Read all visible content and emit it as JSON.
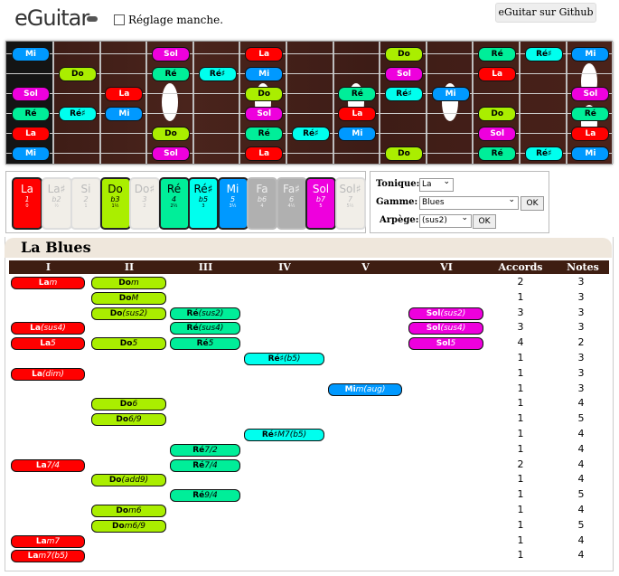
{
  "app": {
    "logo_text": "eGuitar",
    "checkbox_label": "Réglage manche.",
    "github_button": "eGuitar sur Github"
  },
  "colors": {
    "Do": "#aaee00",
    "Ré": "#00ee99",
    "Ré♯": "#00ffee",
    "Mi": "#0099ff",
    "Sol": "#ee00dd",
    "La": "#ff0000"
  },
  "fretboard": {
    "strings": [
      "Mi",
      "Si",
      "Sol",
      "Ré",
      "La",
      "Mi"
    ],
    "notes": [
      {
        "s": 0,
        "f": 0,
        "n": "Mi"
      },
      {
        "s": 0,
        "f": 3,
        "n": "Sol"
      },
      {
        "s": 0,
        "f": 5,
        "n": "La"
      },
      {
        "s": 0,
        "f": 8,
        "n": "Do"
      },
      {
        "s": 0,
        "f": 10,
        "n": "Ré"
      },
      {
        "s": 0,
        "f": 11,
        "n": "Ré♯"
      },
      {
        "s": 0,
        "f": 12,
        "n": "Mi"
      },
      {
        "s": 1,
        "f": 1,
        "n": "Do"
      },
      {
        "s": 1,
        "f": 3,
        "n": "Ré"
      },
      {
        "s": 1,
        "f": 4,
        "n": "Ré♯"
      },
      {
        "s": 1,
        "f": 5,
        "n": "Mi"
      },
      {
        "s": 1,
        "f": 8,
        "n": "Sol"
      },
      {
        "s": 1,
        "f": 10,
        "n": "La"
      },
      {
        "s": 2,
        "f": 0,
        "n": "Sol"
      },
      {
        "s": 2,
        "f": 2,
        "n": "La"
      },
      {
        "s": 2,
        "f": 5,
        "n": "Do"
      },
      {
        "s": 2,
        "f": 7,
        "n": "Ré"
      },
      {
        "s": 2,
        "f": 8,
        "n": "Ré♯"
      },
      {
        "s": 2,
        "f": 9,
        "n": "Mi"
      },
      {
        "s": 2,
        "f": 12,
        "n": "Sol"
      },
      {
        "s": 3,
        "f": 0,
        "n": "Ré"
      },
      {
        "s": 3,
        "f": 1,
        "n": "Ré♯"
      },
      {
        "s": 3,
        "f": 2,
        "n": "Mi"
      },
      {
        "s": 3,
        "f": 5,
        "n": "Sol"
      },
      {
        "s": 3,
        "f": 7,
        "n": "La"
      },
      {
        "s": 3,
        "f": 10,
        "n": "Do"
      },
      {
        "s": 3,
        "f": 12,
        "n": "Ré"
      },
      {
        "s": 4,
        "f": 0,
        "n": "La"
      },
      {
        "s": 4,
        "f": 3,
        "n": "Do"
      },
      {
        "s": 4,
        "f": 5,
        "n": "Ré"
      },
      {
        "s": 4,
        "f": 6,
        "n": "Ré♯"
      },
      {
        "s": 4,
        "f": 7,
        "n": "Mi"
      },
      {
        "s": 4,
        "f": 10,
        "n": "Sol"
      },
      {
        "s": 4,
        "f": 12,
        "n": "La"
      },
      {
        "s": 5,
        "f": 0,
        "n": "Mi"
      },
      {
        "s": 5,
        "f": 3,
        "n": "Sol"
      },
      {
        "s": 5,
        "f": 5,
        "n": "La"
      },
      {
        "s": 5,
        "f": 8,
        "n": "Do"
      },
      {
        "s": 5,
        "f": 10,
        "n": "Ré"
      },
      {
        "s": 5,
        "f": 11,
        "n": "Ré♯"
      },
      {
        "s": 5,
        "f": 12,
        "n": "Mi"
      }
    ]
  },
  "degrees": [
    {
      "name": "La",
      "interval": "1",
      "ratio": "0",
      "active": true,
      "color": "#ff0000",
      "text": "#ffffff"
    },
    {
      "name": "La♯",
      "interval": "b2",
      "ratio": "½",
      "active": false
    },
    {
      "name": "Si",
      "interval": "2",
      "ratio": "1",
      "active": false
    },
    {
      "name": "Do",
      "interval": "b3",
      "ratio": "1½",
      "active": true,
      "color": "#aaee00",
      "text": "#000000"
    },
    {
      "name": "Do♯",
      "interval": "3",
      "ratio": "2",
      "active": false
    },
    {
      "name": "Ré",
      "interval": "4",
      "ratio": "2½",
      "active": true,
      "color": "#00ee99",
      "text": "#000000"
    },
    {
      "name": "Ré♯",
      "interval": "b5",
      "ratio": "3",
      "active": true,
      "color": "#00ffee",
      "text": "#000000"
    },
    {
      "name": "Mi",
      "interval": "5",
      "ratio": "3½",
      "active": true,
      "color": "#0099ff",
      "text": "#ffffff"
    },
    {
      "name": "Fa",
      "interval": "b6",
      "ratio": "4",
      "active": false,
      "dark": true
    },
    {
      "name": "Fa♯",
      "interval": "6",
      "ratio": "4½",
      "active": false,
      "dark": true
    },
    {
      "name": "Sol",
      "interval": "b7",
      "ratio": "5",
      "active": true,
      "color": "#ee00dd",
      "text": "#ffffff"
    },
    {
      "name": "Sol♯",
      "interval": "7",
      "ratio": "5½",
      "active": false
    }
  ],
  "controls": {
    "tonique_label": "Tonique:",
    "tonique_value": "La",
    "gamme_label": "Gamme:",
    "gamme_value": "Blues",
    "ok1": "OK",
    "arpege_label": "Arpège:",
    "arpege_value": "(sus2)",
    "ok2": "OK"
  },
  "table": {
    "title": "La Blues",
    "headers": [
      "I",
      "II",
      "III",
      "IV",
      "V",
      "VI",
      "Accords",
      "Notes"
    ],
    "rows": [
      {
        "chords": [
          {
            "col": 0,
            "root": "La",
            "q": "m"
          },
          {
            "col": 1,
            "root": "Do",
            "q": "m"
          }
        ],
        "accords": "2",
        "notes": "3"
      },
      {
        "chords": [
          {
            "col": 1,
            "root": "Do",
            "q": "M"
          }
        ],
        "accords": "1",
        "notes": "3"
      },
      {
        "chords": [
          {
            "col": 1,
            "root": "Do",
            "q": "(sus2)"
          },
          {
            "col": 2,
            "root": "Ré",
            "q": "(sus2)"
          },
          {
            "col": 5,
            "root": "Sol",
            "q": "(sus2)"
          }
        ],
        "accords": "3",
        "notes": "3"
      },
      {
        "chords": [
          {
            "col": 0,
            "root": "La",
            "q": "(sus4)"
          },
          {
            "col": 2,
            "root": "Ré",
            "q": "(sus4)"
          },
          {
            "col": 5,
            "root": "Sol",
            "q": "(sus4)"
          }
        ],
        "accords": "3",
        "notes": "3"
      },
      {
        "chords": [
          {
            "col": 0,
            "root": "La",
            "q": "5"
          },
          {
            "col": 1,
            "root": "Do",
            "q": "5"
          },
          {
            "col": 2,
            "root": "Ré",
            "q": "5"
          },
          {
            "col": 5,
            "root": "Sol",
            "q": "5"
          }
        ],
        "accords": "4",
        "notes": "2"
      },
      {
        "chords": [
          {
            "col": 3,
            "root": "Ré♯",
            "q": "(b5)"
          }
        ],
        "accords": "1",
        "notes": "3"
      },
      {
        "chords": [
          {
            "col": 0,
            "root": "La",
            "q": "(dim)"
          }
        ],
        "accords": "1",
        "notes": "3"
      },
      {
        "chords": [
          {
            "col": 4,
            "root": "Mi",
            "q": "m(aug)"
          }
        ],
        "accords": "1",
        "notes": "3"
      },
      {
        "chords": [
          {
            "col": 1,
            "root": "Do",
            "q": "6"
          }
        ],
        "accords": "1",
        "notes": "4"
      },
      {
        "chords": [
          {
            "col": 1,
            "root": "Do",
            "q": "6/9"
          }
        ],
        "accords": "1",
        "notes": "5"
      },
      {
        "chords": [
          {
            "col": 3,
            "root": "Ré♯",
            "q": "M7(b5)"
          }
        ],
        "accords": "1",
        "notes": "4"
      },
      {
        "chords": [
          {
            "col": 2,
            "root": "Ré",
            "q": "7/2"
          }
        ],
        "accords": "1",
        "notes": "4"
      },
      {
        "chords": [
          {
            "col": 0,
            "root": "La",
            "q": "7/4"
          },
          {
            "col": 2,
            "root": "Ré",
            "q": "7/4"
          }
        ],
        "accords": "2",
        "notes": "4"
      },
      {
        "chords": [
          {
            "col": 1,
            "root": "Do",
            "q": "(add9)"
          }
        ],
        "accords": "1",
        "notes": "4"
      },
      {
        "chords": [
          {
            "col": 2,
            "root": "Ré",
            "q": "9/4"
          }
        ],
        "accords": "1",
        "notes": "5"
      },
      {
        "chords": [
          {
            "col": 1,
            "root": "Do",
            "q": "m6"
          }
        ],
        "accords": "1",
        "notes": "4"
      },
      {
        "chords": [
          {
            "col": 1,
            "root": "Do",
            "q": "m6/9"
          }
        ],
        "accords": "1",
        "notes": "5"
      },
      {
        "chords": [
          {
            "col": 0,
            "root": "La",
            "q": "m7"
          }
        ],
        "accords": "1",
        "notes": "4"
      },
      {
        "chords": [
          {
            "col": 0,
            "root": "La",
            "q": "m7(b5)"
          }
        ],
        "accords": "1",
        "notes": "4"
      }
    ]
  }
}
